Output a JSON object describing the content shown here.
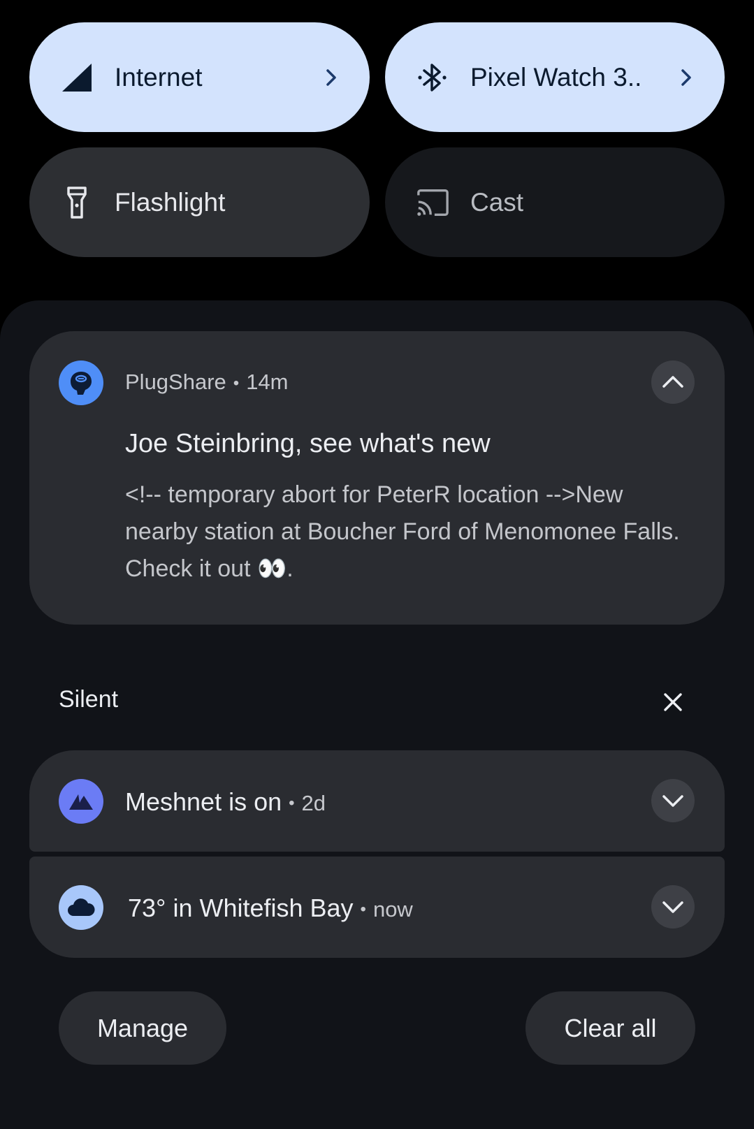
{
  "quick_settings": {
    "internet": {
      "label": "Internet",
      "icon": "cellular-signal-icon",
      "state": "on"
    },
    "bluetooth": {
      "label": "Pixel Watch 3..",
      "icon": "bluetooth-icon",
      "state": "on"
    },
    "flashlight": {
      "label": "Flashlight",
      "icon": "flashlight-icon",
      "state": "off"
    },
    "cast": {
      "label": "Cast",
      "icon": "cast-icon",
      "state": "unavailable"
    }
  },
  "notifications": {
    "plugshare": {
      "app": "PlugShare",
      "time": "14m",
      "title": "Joe Steinbring, see what's new",
      "body": "<!-- temporary abort for PeterR location -->New nearby station at Boucher Ford of Menomonee Falls. Check it out 👀.",
      "icon": "plugshare-icon",
      "icon_color": "#4f8ef7",
      "expand_icon": "chevron-up-icon"
    }
  },
  "silent_section": {
    "label": "Silent",
    "close_icon": "close-icon",
    "items": [
      {
        "title": "Meshnet is on",
        "time": "2d",
        "icon": "nordvpn-icon",
        "icon_color": "#6b7cf5"
      },
      {
        "title": "73° in Whitefish Bay",
        "time": "now",
        "icon": "cloud-icon",
        "icon_color": "#a8c7fa"
      }
    ]
  },
  "actions": {
    "manage_label": "Manage",
    "clear_all_label": "Clear all"
  },
  "colors": {
    "tile_on": "#d3e3fd",
    "tile_off": "#2d2f33",
    "shade_bg": "#111318",
    "card_bg": "#2a2c31"
  }
}
